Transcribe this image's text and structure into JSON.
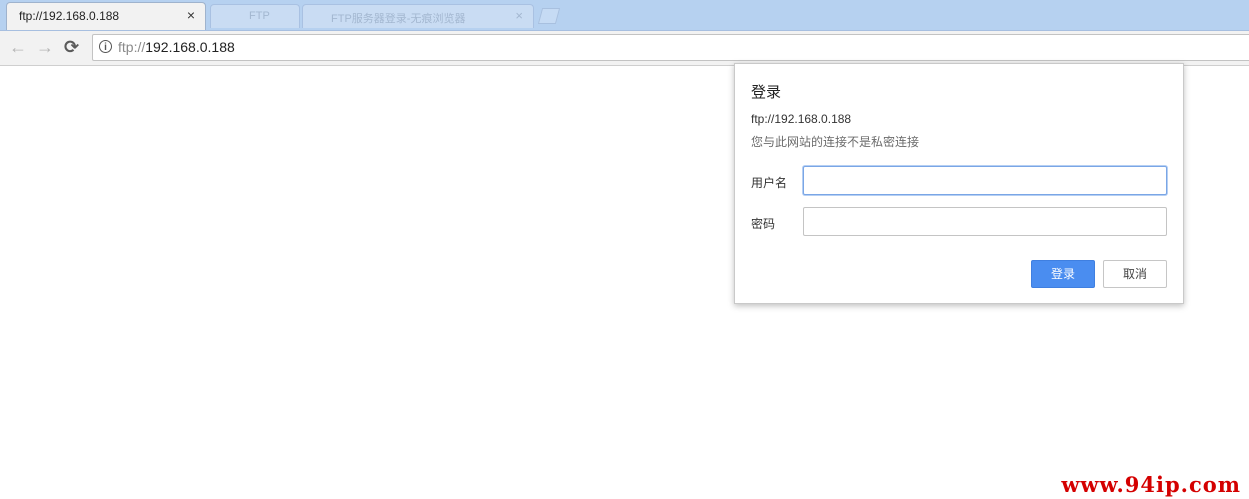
{
  "tabs": {
    "active_title": "ftp://192.168.0.188",
    "close_glyph": "×",
    "bg_tab2_text": "FTP",
    "bg_tab3_text": "FTP服务器登录-无痕浏览器",
    "bg_tab3_close": "×"
  },
  "toolbar": {
    "back_icon": "←",
    "forward_icon": "→",
    "reload_icon": "⟳",
    "info_icon": "i",
    "url_scheme": "ftp://",
    "url_host": "192.168.0.188"
  },
  "dialog": {
    "title": "登录",
    "origin": "ftp://192.168.0.188",
    "warning": "您与此网站的连接不是私密连接",
    "username_label": "用户名",
    "username_value": "",
    "password_label": "密码",
    "password_value": "",
    "login_button": "登录",
    "cancel_button": "取消"
  },
  "watermark": "www.94ip.com",
  "colors": {
    "tabstrip": "#b6d1f0",
    "primary_button": "#4a8df0",
    "watermark": "#d40000"
  }
}
